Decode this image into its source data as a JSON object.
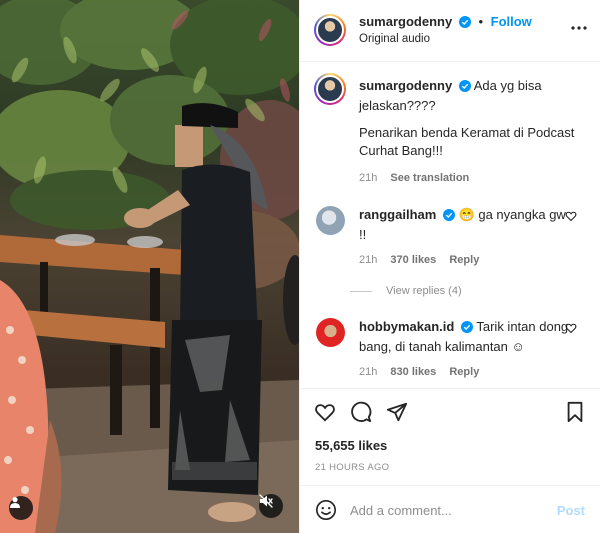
{
  "post_author": {
    "username": "sumargodenny",
    "follow_label": "Follow",
    "separator": "•",
    "audio": "Original audio"
  },
  "caption": {
    "username": "sumargodenny",
    "line1": "Ada yg bisa",
    "line2": "jelaskan????",
    "line3": "Penarikan benda Keramat di Podcast",
    "line4": "Curhat Bang!!!",
    "time": "21h",
    "translate": "See translation"
  },
  "comments": [
    {
      "username": "ranggailham",
      "emoji": "😁",
      "text1": "ga nyangka gw",
      "text2": "!!",
      "time": "21h",
      "likes": "370 likes",
      "reply": "Reply",
      "view_replies": "View replies (4)"
    },
    {
      "username": "hobbymakan.id",
      "text1": "Tarik intan dong",
      "text2": "bang, di tanah kalimantan",
      "emoji": "☺",
      "time": "21h",
      "likes": "830 likes",
      "reply": "Reply"
    }
  ],
  "stats": {
    "likes": "55,655 likes",
    "posted": "21 HOURS AGO"
  },
  "add_comment": {
    "placeholder": "Add a comment...",
    "post_label": "Post"
  },
  "icons": {
    "more": "more-options-icon",
    "verified": "verified-badge-icon",
    "like": "heart-icon",
    "comment": "comment-icon",
    "share": "send-icon",
    "save": "bookmark-icon",
    "emoji": "emoji-icon",
    "user": "user-tag-icon",
    "mute": "muted-speaker-icon"
  },
  "colors": {
    "accent": "#0095f6",
    "verified": "#0095f6",
    "post_disabled": "#b3dbff",
    "muted_text": "#8e8e8e"
  }
}
